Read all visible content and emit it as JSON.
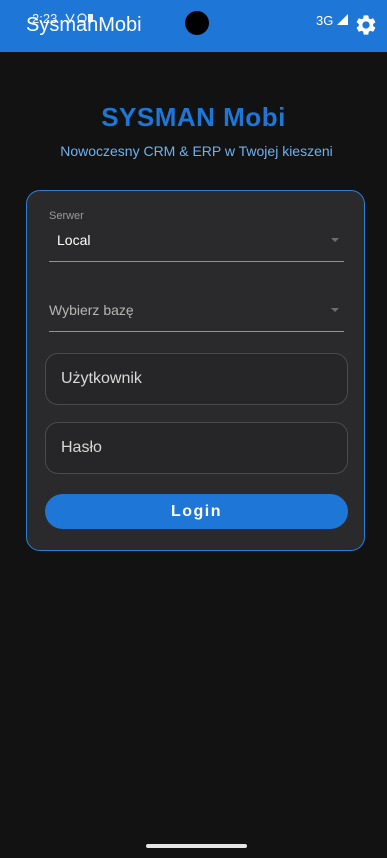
{
  "status_bar": {
    "time": "2:23",
    "network": "3G"
  },
  "app_bar": {
    "title": "SysmanMobi",
    "settings_icon": "gear-icon",
    "color": "#1e76d6"
  },
  "brand": {
    "title": "SYSMAN Mobi",
    "subtitle": "Nowoczesny CRM & ERP w Twojej kieszeni"
  },
  "form": {
    "server": {
      "label": "Serwer",
      "value": "Local"
    },
    "database": {
      "placeholder": "Wybierz bazę"
    },
    "username": {
      "placeholder": "Użytkownik",
      "value": ""
    },
    "password": {
      "placeholder": "Hasło",
      "value": ""
    },
    "login_label": "Login"
  },
  "colors": {
    "accent": "#1e76d6",
    "background": "#121212",
    "card": "#2a2a2c",
    "subtitle": "#6db1f0"
  }
}
